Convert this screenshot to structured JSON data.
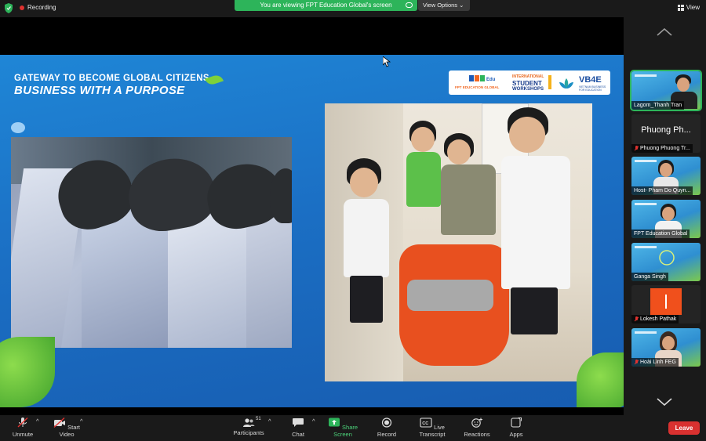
{
  "topbar": {
    "recording_label": "Recording",
    "viewing_banner": "You are viewing FPT Education Global's screen",
    "view_options_label": "View Options",
    "view_label": "View"
  },
  "slide": {
    "title_line1": "GATEWAY TO BECOME GLOBAL CITIZENS",
    "title_line2": "BUSINESS WITH A PURPOSE",
    "logos": {
      "fpt": "FPT EDUCATION GLOBAL",
      "isw_line1": "INTERNATIONAL",
      "isw_line2": "STUDENT",
      "isw_line3": "WORKSHOPS",
      "vb4e": "VB4E",
      "vb4e_sub": "VIETNAM BUSINESS FOR EDUCATION"
    }
  },
  "participants": [
    {
      "name": "Lagom_Thanh Tran",
      "muted": false,
      "video": true
    },
    {
      "name": "Phuong Phuong Tr...",
      "display_name": "Phuong Ph...",
      "muted": true,
      "video": false
    },
    {
      "name": "Host- Pham Do Quyn...",
      "muted": false,
      "video": true
    },
    {
      "name": "FPT Education Global",
      "muted": false,
      "video": true
    },
    {
      "name": "Ganga Singh",
      "muted": false,
      "video": true
    },
    {
      "name": "Lokesh Pathak",
      "muted": true,
      "video": true
    },
    {
      "name": "Hoài Linh FEG",
      "muted": true,
      "video": true
    }
  ],
  "toolbar": {
    "unmute": "Unmute",
    "start_video": "Start Video",
    "participants": "Participants",
    "participants_count": "51",
    "chat": "Chat",
    "share_screen": "Share Screen",
    "record": "Record",
    "live_transcript": "Live Transcript",
    "reactions": "Reactions",
    "apps": "Apps",
    "leave": "Leave"
  },
  "colors": {
    "share_green": "#2db45a",
    "leave_red": "#d93130",
    "slide_blue": "#1b6fc4"
  }
}
